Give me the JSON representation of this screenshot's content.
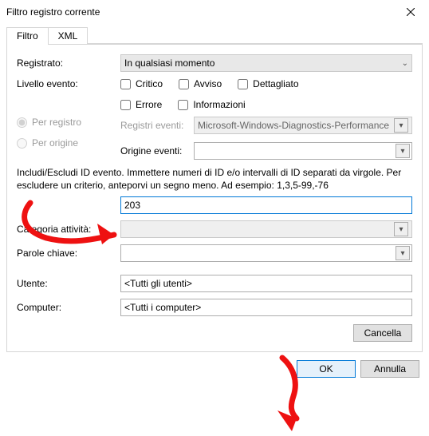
{
  "window": {
    "title": "Filtro registro corrente"
  },
  "tabs": {
    "filter": "Filtro",
    "xml": "XML"
  },
  "labels": {
    "registrato": "Registrato:",
    "livello": "Livello evento:",
    "per_registro": "Per registro",
    "per_origine": "Per origine",
    "registri_eventi": "Registri eventi:",
    "origine_eventi": "Origine eventi:",
    "categoria": "Categoria attività:",
    "parole_chiave": "Parole chiave:",
    "utente": "Utente:",
    "computer": "Computer:"
  },
  "registrato_value": "In qualsiasi momento",
  "level_checks": {
    "critico": "Critico",
    "avviso": "Avviso",
    "dettagliato": "Dettagliato",
    "errore": "Errore",
    "informazioni": "Informazioni"
  },
  "registri_value": "Microsoft-Windows-Diagnostics-Performance",
  "help_text": "Includi/Escludi ID evento. Immettere numeri di ID e/o intervalli di ID separati da virgole. Per escludere un criterio, anteporvi un segno meno. Ad esempio: 1,3,5-99,-76",
  "event_id_value": "203",
  "utente_value": "<Tutti gli utenti>",
  "computer_value": "<Tutti i computer>",
  "buttons": {
    "cancella": "Cancella",
    "ok": "OK",
    "annulla": "Annulla"
  }
}
